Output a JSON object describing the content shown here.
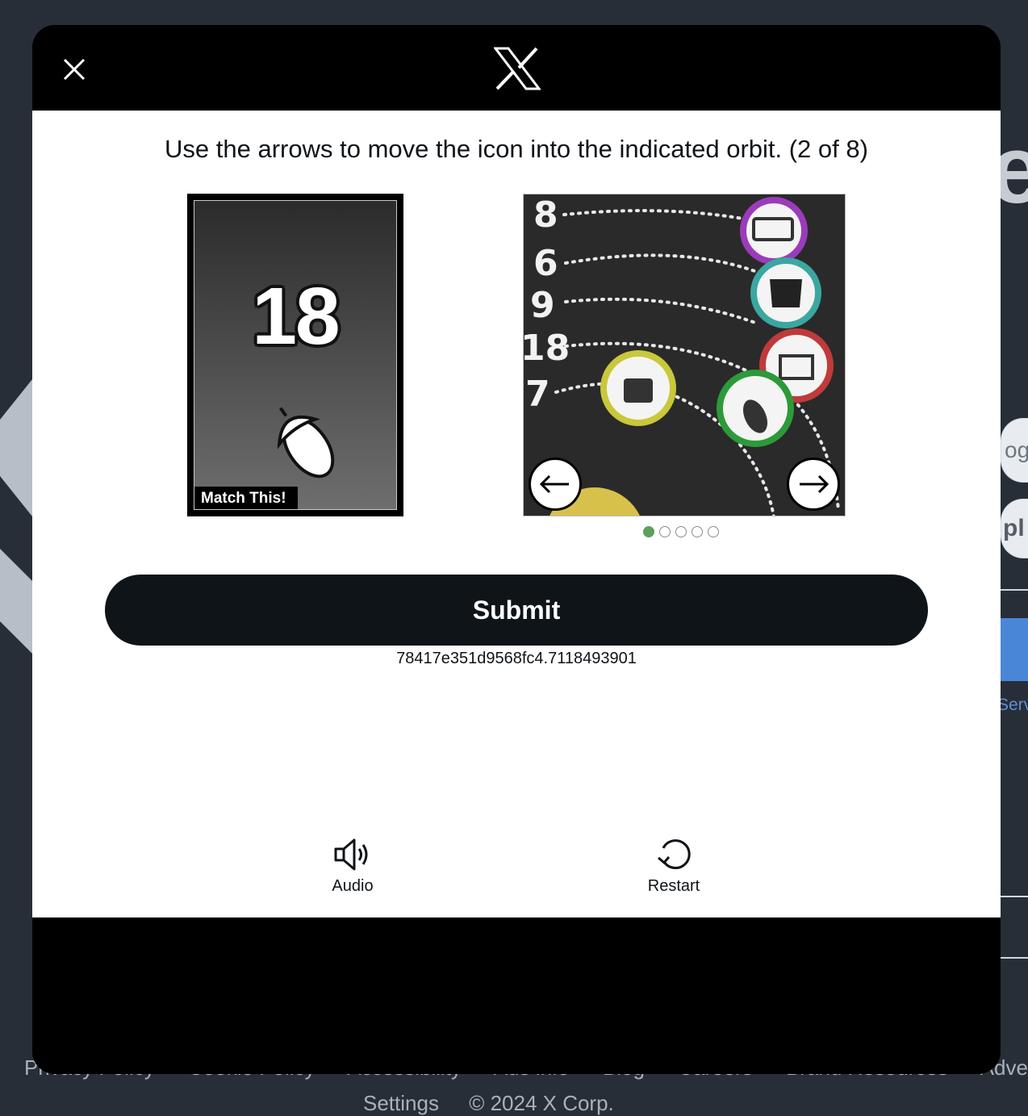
{
  "background": {
    "big_letter": "e",
    "google_button_fragment": "ogl",
    "apple_button_fragment": "pl",
    "terms_fragment": "Serv",
    "footer_links": [
      "Privacy Policy",
      "Cookie Policy",
      "Accessibility",
      "Ads info",
      "Blog",
      "Careers",
      "Brand Resources",
      "Advertis"
    ],
    "footer_row2": [
      "Settings",
      "© 2024 X Corp."
    ]
  },
  "modal": {
    "logo": "x-logo",
    "close_icon": "close-icon",
    "instructions": "Use the arrows to move the icon into the indicated orbit. (2 of 8)",
    "target": {
      "number": "18",
      "icon": "acorn-icon",
      "label": "Match This!"
    },
    "puzzle": {
      "orbit_labels": [
        "8",
        "6",
        "9",
        "18",
        "7"
      ],
      "planet_icons": [
        "truck-icon",
        "dog-icon",
        "shop-icon",
        "acorn-icon",
        "bag-icon"
      ],
      "left_arrow": "arrow-left-icon",
      "right_arrow": "arrow-right-icon",
      "page_count": 5,
      "current_page": 1
    },
    "submit_label": "Submit",
    "session_id": "78417e351d9568fc4.7118493901",
    "tools": {
      "audio_label": "Audio",
      "restart_label": "Restart"
    }
  },
  "colors": {
    "page_bg": "#282e37",
    "modal_header": "#000000",
    "submit_bg": "#0f1419",
    "active_dot": "#5da05d"
  }
}
